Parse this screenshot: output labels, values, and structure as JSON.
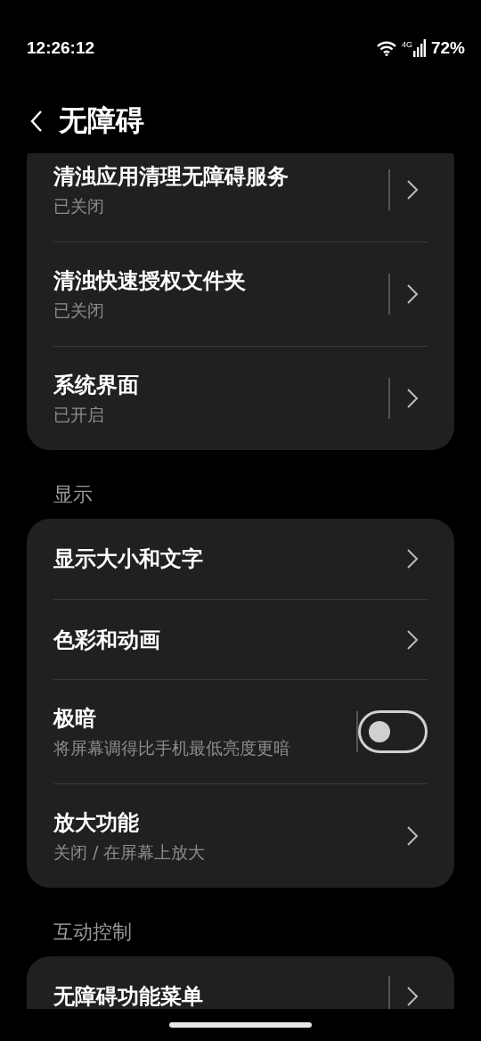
{
  "status_bar": {
    "time": "12:26:12",
    "network": "4G",
    "battery": "72%"
  },
  "header": {
    "title": "无障碍"
  },
  "sections": [
    {
      "items": [
        {
          "kind": "split",
          "title": "清浊应用清理无障碍服务",
          "subtitle": "已关闭"
        },
        {
          "kind": "split",
          "title": "清浊快速授权文件夹",
          "subtitle": "已关闭"
        },
        {
          "kind": "split",
          "title": "系统界面",
          "subtitle": "已开启"
        }
      ]
    },
    {
      "label": "显示",
      "items": [
        {
          "kind": "link",
          "title": "显示大小和文字"
        },
        {
          "kind": "link",
          "title": "色彩和动画"
        },
        {
          "kind": "toggle",
          "title": "极暗",
          "subtitle": "将屏幕调得比手机最低亮度更暗",
          "on": false
        },
        {
          "kind": "link",
          "title": "放大功能",
          "subtitle": "关闭 / 在屏幕上放大"
        }
      ]
    },
    {
      "label": "互动控制",
      "items": [
        {
          "kind": "split",
          "title": "无障碍功能菜单"
        }
      ]
    }
  ]
}
